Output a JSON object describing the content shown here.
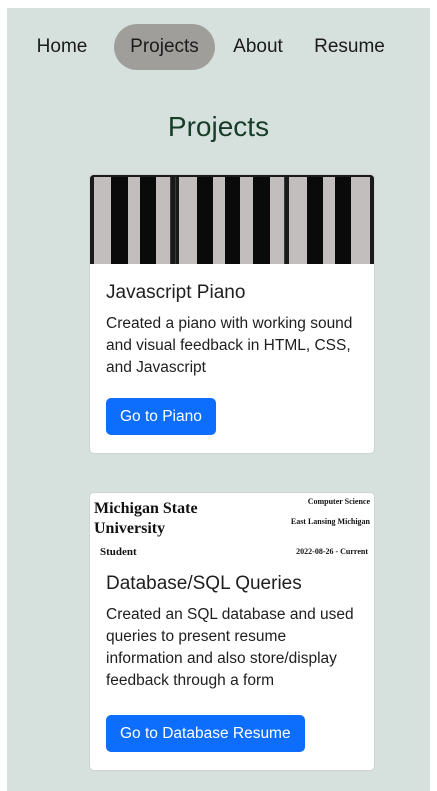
{
  "nav": {
    "items": [
      {
        "label": "Home"
      },
      {
        "label": "Projects"
      },
      {
        "label": "About"
      },
      {
        "label": "Resume"
      }
    ],
    "active": "Projects"
  },
  "page": {
    "title": "Projects"
  },
  "colors": {
    "background": "#d6e0dd",
    "nav_active": "#a09e9b",
    "title": "#173d29",
    "button": "#0d6efd"
  },
  "cards": [
    {
      "image": "piano-keys",
      "title": "Javascript Piano",
      "text": "Created a piano with working sound and visual feedback in HTML, CSS, and Javascript",
      "button_label": "Go to Piano"
    },
    {
      "image": "resume-snippet",
      "image_text": {
        "institution": "Michigan State University",
        "department": "Computer Science",
        "location": "East Lansing Michigan",
        "role": "Student",
        "dates": "2022-08-26 - Current"
      },
      "title": "Database/SQL Queries",
      "text": "Created an SQL database and used queries to present resume information and also store/display feedback through a form",
      "button_label": "Go to Database Resume"
    }
  ]
}
